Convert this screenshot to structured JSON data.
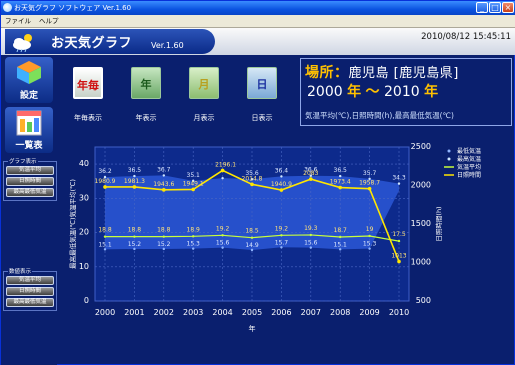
{
  "window": {
    "title": "お天気グラフ ソフトウェア Ver.1.60"
  },
  "menu": [
    "ファイル",
    "ヘルプ"
  ],
  "header": {
    "app_name": "お天気グラフ",
    "version": "Ver.1.60",
    "datetime": "2010/08/12 15:45:11"
  },
  "sidebar": {
    "settings_label": "設定",
    "list_label": "一覧表",
    "graph_group": {
      "title": "グラフ表示",
      "buttons": [
        "気温平均",
        "日照時間",
        "最高最低気温"
      ]
    },
    "numeric_group": {
      "title": "数値表示",
      "buttons": [
        "気温平均",
        "日照時間",
        "最高最低気温"
      ]
    }
  },
  "modes": [
    {
      "icon_text": "年毎",
      "label": "年毎表示",
      "selected": true
    },
    {
      "icon_text": "年",
      "label": "年表示"
    },
    {
      "icon_text": "月",
      "label": "月表示"
    },
    {
      "icon_text": "日",
      "label": "日表示"
    }
  ],
  "info": {
    "place_key": "場所：",
    "place_value": "鹿児島 [鹿児島県]",
    "start": "2000",
    "end": "2010",
    "year_unit": "年",
    "tilde": "～",
    "subtitle": "気温平均(℃),日照時間(h),最高最低気温(℃)"
  },
  "chart_data": {
    "type": "line",
    "x": [
      "2000",
      "2001",
      "2002",
      "2003",
      "2004",
      "2005",
      "2006",
      "2007",
      "2008",
      "2009",
      "2010"
    ],
    "xlabel": "年",
    "ylabel": "最高最低気温(℃)気温平均(℃)",
    "y2label": "日照時間(h)",
    "ylim": [
      0,
      45
    ],
    "y2lim": [
      500,
      2500
    ],
    "yticks": [
      0,
      10,
      20,
      30,
      40
    ],
    "y2ticks": [
      500,
      1000,
      1500,
      2000,
      2500
    ],
    "series": [
      {
        "name": "最高気温",
        "axis": "left",
        "values": [
          36.2,
          36.5,
          36.7,
          35.1,
          35.9,
          35.6,
          36.4,
          36.6,
          36.5,
          35.7,
          34.3
        ],
        "labels": [
          "36.2",
          "36.5",
          "36.7",
          "35.1",
          "",
          "35.6",
          "36.4",
          "36.6",
          "36.5",
          "35.7",
          "34.3"
        ],
        "color": "#cfe6ff"
      },
      {
        "name": "最低気温",
        "axis": "left",
        "values": [
          15.1,
          15.2,
          15.2,
          15.3,
          15.6,
          14.9,
          15.7,
          15.6,
          15.1,
          15.3,
          null
        ],
        "labels": [
          "15.1",
          "15.2",
          "15.2",
          "15.3",
          "15.6",
          "14.9",
          "15.7",
          "15.6",
          "15.1",
          "15.3",
          ""
        ],
        "color": "#8fb4ff"
      },
      {
        "name": "気温平均",
        "axis": "left",
        "values": [
          18.8,
          18.8,
          18.8,
          18.9,
          19.2,
          18.5,
          19.2,
          19.3,
          18.7,
          19.0,
          17.5
        ],
        "labels": [
          "18.8",
          "18.8",
          "18.8",
          "18.9",
          "19.2",
          "18.5",
          "19.2",
          "19.3",
          "18.7",
          "19",
          "17.5"
        ],
        "color": "#c8ff3c"
      },
      {
        "name": "日照時間",
        "axis": "right",
        "values": [
          1980.9,
          1981.3,
          1943.6,
          1949.1,
          2196.1,
          2014.8,
          1940.9,
          2083,
          1973.4,
          1958.7,
          1013
        ],
        "labels": [
          "1980.9",
          "1981.3",
          "1943.6",
          "1949.1",
          "2196.1",
          "2014.8",
          "1940.9",
          "2083",
          "1973.4",
          "1958.7",
          "1013"
        ],
        "color": "#ffe600"
      }
    ],
    "legend": [
      "最低気温",
      "最高気温",
      "気温平均",
      "日照時間"
    ],
    "grid": true
  }
}
